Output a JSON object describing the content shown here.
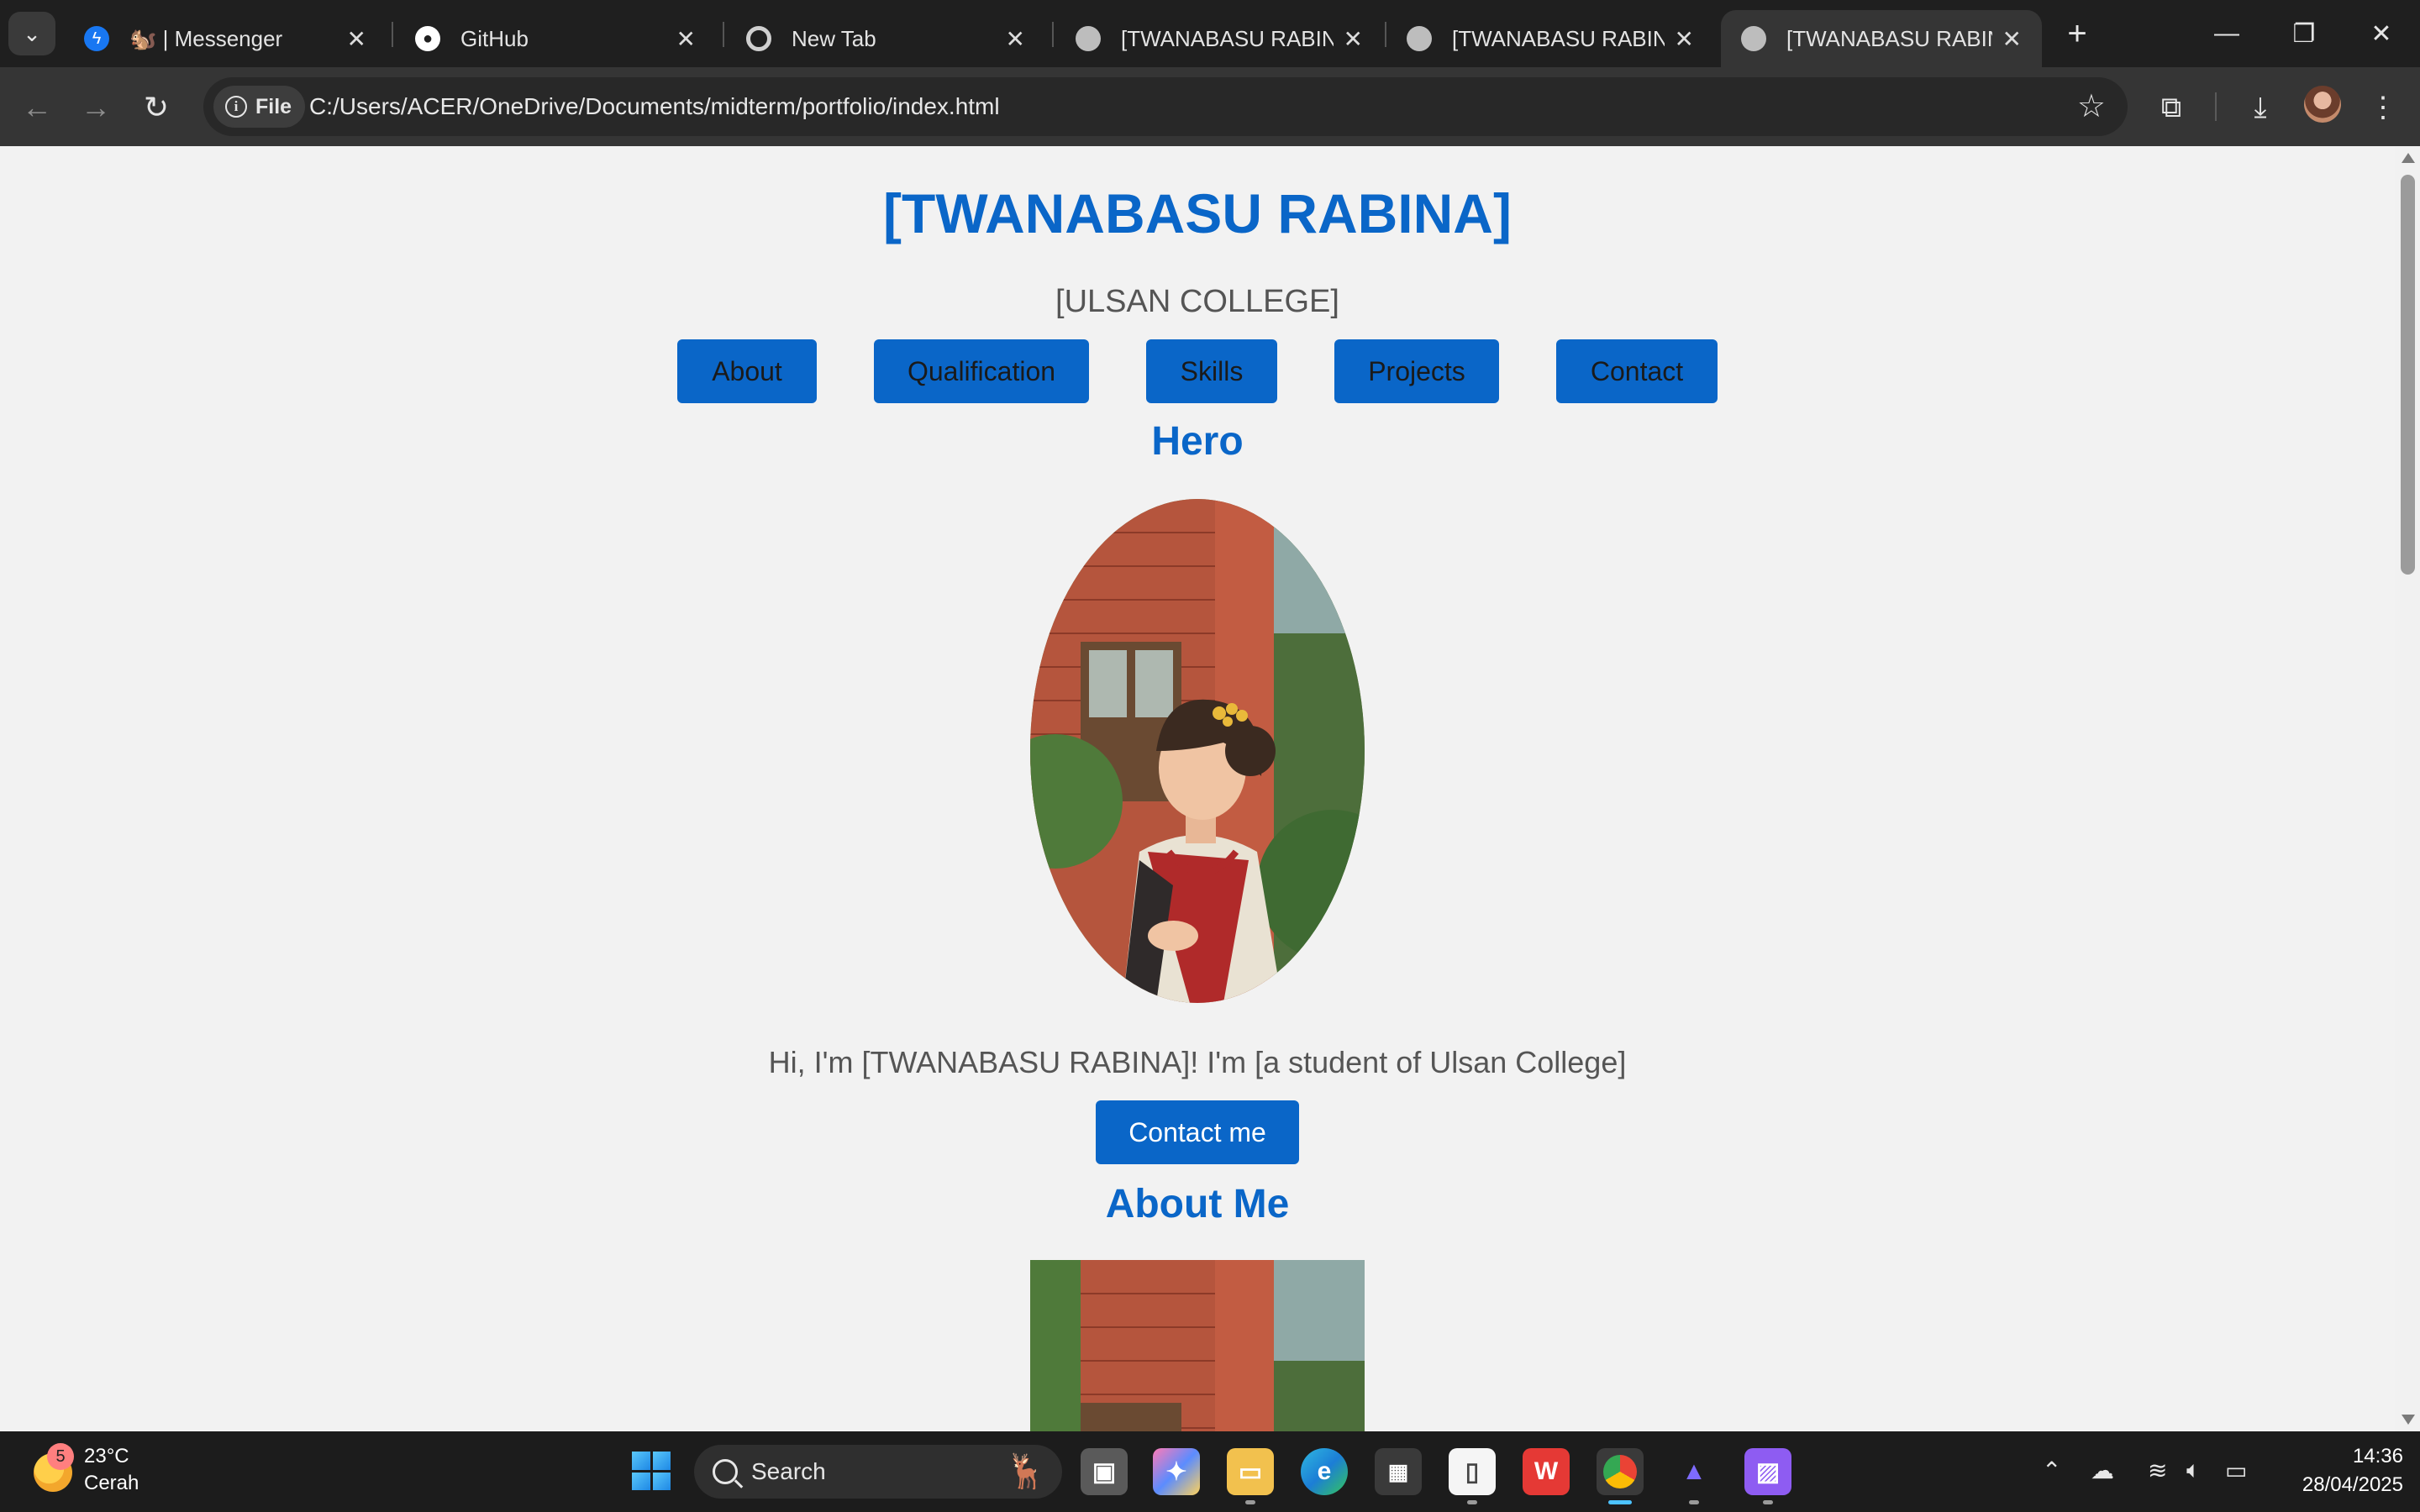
{
  "browser": {
    "tabs": [
      {
        "title": "🐿️ | Messenger",
        "favicon": "messenger-icon"
      },
      {
        "title": "GitHub",
        "favicon": "github-icon"
      },
      {
        "title": "New Tab",
        "favicon": "chrome-icon"
      },
      {
        "title": "[TWANABASU RABINA]",
        "favicon": "globe-icon"
      },
      {
        "title": "[TWANABASU RABINA]",
        "favicon": "globe-icon"
      },
      {
        "title": "[TWANABASU RABINA]",
        "favicon": "globe-icon",
        "active": true
      }
    ],
    "address": {
      "chip": "File",
      "url": "C:/Users/ACER/OneDrive/Documents/midterm/portfolio/index.html"
    }
  },
  "page": {
    "title": "[TWANABASU RABINA]",
    "subtitle": "[ULSAN COLLEGE]",
    "nav": [
      "About",
      "Qualification",
      "Skills",
      "Projects",
      "Contact"
    ],
    "hero_heading": "Hero",
    "intro": "Hi, I'm [TWANABASU RABINA]! I'm [a student of Ulsan College]",
    "cta": "Contact me",
    "about_heading": "About Me",
    "accent": "#0a66c8"
  },
  "taskbar": {
    "weather": {
      "temp": "23°C",
      "desc": "Cerah",
      "badge": "5"
    },
    "search": "Search",
    "time": "14:36",
    "date": "28/04/2025"
  }
}
